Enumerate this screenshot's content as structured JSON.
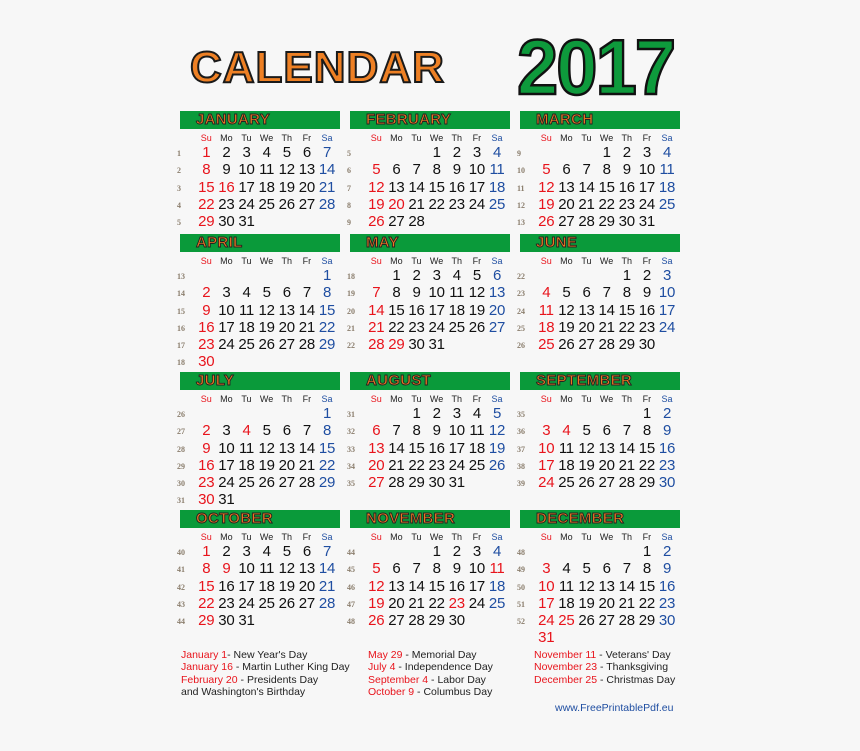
{
  "header": {
    "title": "CALENDAR",
    "year": "2017"
  },
  "colors": {
    "month_bar": "#0a9a3a",
    "title_orange": "#ee8024",
    "year_green": "#0e9a3c",
    "sunday_holiday_red": "#e8141c",
    "saturday_blue": "#1f4ea1"
  },
  "weekdays": [
    "Su",
    "Mo",
    "Tu",
    "We",
    "Th",
    "Fr",
    "Sa"
  ],
  "months": [
    {
      "name": "JANUARY",
      "weeks": [
        {
          "wk": "1",
          "days": [
            "1",
            "2",
            "3",
            "4",
            "5",
            "6",
            "7"
          ]
        },
        {
          "wk": "2",
          "days": [
            "8",
            "9",
            "10",
            "11",
            "12",
            "13",
            "14"
          ]
        },
        {
          "wk": "3",
          "days": [
            "15",
            "16",
            "17",
            "18",
            "19",
            "20",
            "21"
          ]
        },
        {
          "wk": "4",
          "days": [
            "22",
            "23",
            "24",
            "25",
            "26",
            "27",
            "28"
          ]
        },
        {
          "wk": "5",
          "days": [
            "29",
            "30",
            "31",
            "",
            "",
            "",
            ""
          ]
        }
      ],
      "holidays": [
        "1",
        "16"
      ]
    },
    {
      "name": "FEBRUARY",
      "weeks": [
        {
          "wk": "5",
          "days": [
            "",
            "",
            "",
            "1",
            "2",
            "3",
            "4"
          ]
        },
        {
          "wk": "6",
          "days": [
            "5",
            "6",
            "7",
            "8",
            "9",
            "10",
            "11"
          ]
        },
        {
          "wk": "7",
          "days": [
            "12",
            "13",
            "14",
            "15",
            "16",
            "17",
            "18"
          ]
        },
        {
          "wk": "8",
          "days": [
            "19",
            "20",
            "21",
            "22",
            "23",
            "24",
            "25"
          ]
        },
        {
          "wk": "9",
          "days": [
            "26",
            "27",
            "28",
            "",
            "",
            "",
            ""
          ]
        }
      ],
      "holidays": [
        "20"
      ]
    },
    {
      "name": "MARCH",
      "weeks": [
        {
          "wk": "9",
          "days": [
            "",
            "",
            "",
            "1",
            "2",
            "3",
            "4"
          ]
        },
        {
          "wk": "10",
          "days": [
            "5",
            "6",
            "7",
            "8",
            "9",
            "10",
            "11"
          ]
        },
        {
          "wk": "11",
          "days": [
            "12",
            "13",
            "14",
            "15",
            "16",
            "17",
            "18"
          ]
        },
        {
          "wk": "12",
          "days": [
            "19",
            "20",
            "21",
            "22",
            "23",
            "24",
            "25"
          ]
        },
        {
          "wk": "13",
          "days": [
            "26",
            "27",
            "28",
            "29",
            "30",
            "31",
            ""
          ]
        }
      ],
      "holidays": []
    },
    {
      "name": "APRIL",
      "weeks": [
        {
          "wk": "13",
          "days": [
            "",
            "",
            "",
            "",
            "",
            "",
            "1"
          ]
        },
        {
          "wk": "14",
          "days": [
            "2",
            "3",
            "4",
            "5",
            "6",
            "7",
            "8"
          ]
        },
        {
          "wk": "15",
          "days": [
            "9",
            "10",
            "11",
            "12",
            "13",
            "14",
            "15"
          ]
        },
        {
          "wk": "16",
          "days": [
            "16",
            "17",
            "18",
            "19",
            "20",
            "21",
            "22"
          ]
        },
        {
          "wk": "17",
          "days": [
            "23",
            "24",
            "25",
            "26",
            "27",
            "28",
            "29"
          ]
        },
        {
          "wk": "18",
          "days": [
            "30",
            "",
            "",
            "",
            "",
            "",
            ""
          ]
        }
      ],
      "holidays": []
    },
    {
      "name": "MAY",
      "weeks": [
        {
          "wk": "18",
          "days": [
            "",
            "1",
            "2",
            "3",
            "4",
            "5",
            "6"
          ]
        },
        {
          "wk": "19",
          "days": [
            "7",
            "8",
            "9",
            "10",
            "11",
            "12",
            "13"
          ]
        },
        {
          "wk": "20",
          "days": [
            "14",
            "15",
            "16",
            "17",
            "18",
            "19",
            "20"
          ]
        },
        {
          "wk": "21",
          "days": [
            "21",
            "22",
            "23",
            "24",
            "25",
            "26",
            "27"
          ]
        },
        {
          "wk": "22",
          "days": [
            "28",
            "29",
            "30",
            "31",
            "",
            "",
            ""
          ]
        }
      ],
      "holidays": [
        "29"
      ]
    },
    {
      "name": "JUNE",
      "weeks": [
        {
          "wk": "22",
          "days": [
            "",
            "",
            "",
            "",
            "1",
            "2",
            "3"
          ]
        },
        {
          "wk": "23",
          "days": [
            "4",
            "5",
            "6",
            "7",
            "8",
            "9",
            "10"
          ]
        },
        {
          "wk": "24",
          "days": [
            "11",
            "12",
            "13",
            "14",
            "15",
            "16",
            "17"
          ]
        },
        {
          "wk": "25",
          "days": [
            "18",
            "19",
            "20",
            "21",
            "22",
            "23",
            "24"
          ]
        },
        {
          "wk": "26",
          "days": [
            "25",
            "26",
            "27",
            "28",
            "29",
            "30",
            ""
          ]
        }
      ],
      "holidays": []
    },
    {
      "name": "JULY",
      "weeks": [
        {
          "wk": "26",
          "days": [
            "",
            "",
            "",
            "",
            "",
            "",
            "1"
          ]
        },
        {
          "wk": "27",
          "days": [
            "2",
            "3",
            "4",
            "5",
            "6",
            "7",
            "8"
          ]
        },
        {
          "wk": "28",
          "days": [
            "9",
            "10",
            "11",
            "12",
            "13",
            "14",
            "15"
          ]
        },
        {
          "wk": "29",
          "days": [
            "16",
            "17",
            "18",
            "19",
            "20",
            "21",
            "22"
          ]
        },
        {
          "wk": "30",
          "days": [
            "23",
            "24",
            "25",
            "26",
            "27",
            "28",
            "29"
          ]
        },
        {
          "wk": "31",
          "days": [
            "30",
            "31",
            "",
            "",
            "",
            "",
            ""
          ]
        }
      ],
      "holidays": [
        "4"
      ]
    },
    {
      "name": "AUGUST",
      "weeks": [
        {
          "wk": "31",
          "days": [
            "",
            "",
            "1",
            "2",
            "3",
            "4",
            "5"
          ]
        },
        {
          "wk": "32",
          "days": [
            "6",
            "7",
            "8",
            "9",
            "10",
            "11",
            "12"
          ]
        },
        {
          "wk": "33",
          "days": [
            "13",
            "14",
            "15",
            "16",
            "17",
            "18",
            "19"
          ]
        },
        {
          "wk": "34",
          "days": [
            "20",
            "21",
            "22",
            "23",
            "24",
            "25",
            "26"
          ]
        },
        {
          "wk": "35",
          "days": [
            "27",
            "28",
            "29",
            "30",
            "31",
            "",
            ""
          ]
        }
      ],
      "holidays": []
    },
    {
      "name": "SEPTEMBER",
      "weeks": [
        {
          "wk": "35",
          "days": [
            "",
            "",
            "",
            "",
            "",
            "1",
            "2"
          ]
        },
        {
          "wk": "36",
          "days": [
            "3",
            "4",
            "5",
            "6",
            "7",
            "8",
            "9"
          ]
        },
        {
          "wk": "37",
          "days": [
            "10",
            "11",
            "12",
            "13",
            "14",
            "15",
            "16"
          ]
        },
        {
          "wk": "38",
          "days": [
            "17",
            "18",
            "19",
            "20",
            "21",
            "22",
            "23"
          ]
        },
        {
          "wk": "39",
          "days": [
            "24",
            "25",
            "26",
            "27",
            "28",
            "29",
            "30"
          ]
        }
      ],
      "holidays": [
        "4"
      ]
    },
    {
      "name": "OCTOBER",
      "weeks": [
        {
          "wk": "40",
          "days": [
            "1",
            "2",
            "3",
            "4",
            "5",
            "6",
            "7"
          ]
        },
        {
          "wk": "41",
          "days": [
            "8",
            "9",
            "10",
            "11",
            "12",
            "13",
            "14"
          ]
        },
        {
          "wk": "42",
          "days": [
            "15",
            "16",
            "17",
            "18",
            "19",
            "20",
            "21"
          ]
        },
        {
          "wk": "43",
          "days": [
            "22",
            "23",
            "24",
            "25",
            "26",
            "27",
            "28"
          ]
        },
        {
          "wk": "44",
          "days": [
            "29",
            "30",
            "31",
            "",
            "",
            "",
            ""
          ]
        }
      ],
      "holidays": [
        "9"
      ]
    },
    {
      "name": "NOVEMBER",
      "weeks": [
        {
          "wk": "44",
          "days": [
            "",
            "",
            "",
            "1",
            "2",
            "3",
            "4"
          ]
        },
        {
          "wk": "45",
          "days": [
            "5",
            "6",
            "7",
            "8",
            "9",
            "10",
            "11"
          ]
        },
        {
          "wk": "46",
          "days": [
            "12",
            "13",
            "14",
            "15",
            "16",
            "17",
            "18"
          ]
        },
        {
          "wk": "47",
          "days": [
            "19",
            "20",
            "21",
            "22",
            "23",
            "24",
            "25"
          ]
        },
        {
          "wk": "48",
          "days": [
            "26",
            "27",
            "28",
            "29",
            "30",
            "",
            ""
          ]
        }
      ],
      "holidays": [
        "11",
        "23"
      ]
    },
    {
      "name": "DECEMBER",
      "weeks": [
        {
          "wk": "48",
          "days": [
            "",
            "",
            "",
            "",
            "",
            "1",
            "2"
          ]
        },
        {
          "wk": "49",
          "days": [
            "3",
            "4",
            "5",
            "6",
            "7",
            "8",
            "9"
          ]
        },
        {
          "wk": "50",
          "days": [
            "10",
            "11",
            "12",
            "13",
            "14",
            "15",
            "16"
          ]
        },
        {
          "wk": "51",
          "days": [
            "17",
            "18",
            "19",
            "20",
            "21",
            "22",
            "23"
          ]
        },
        {
          "wk": "52",
          "days": [
            "24",
            "25",
            "26",
            "27",
            "28",
            "29",
            "30"
          ]
        },
        {
          "wk": "",
          "days": [
            "31",
            "",
            "",
            "",
            "",
            "",
            ""
          ]
        }
      ],
      "holidays": [
        "25"
      ]
    }
  ],
  "holiday_list": {
    "col1": [
      {
        "date": "January 1",
        "sep": "- ",
        "name": "New Year's Day"
      },
      {
        "date": "January 16",
        "sep": " - ",
        "name": "Martin Luther King Day"
      },
      {
        "date": "February 20",
        "sep": " - ",
        "name": "Presidents Day"
      },
      {
        "date": "",
        "sep": "",
        "name": "and Washington's Birthday"
      }
    ],
    "col2": [
      {
        "date": "May 29",
        "sep": " - ",
        "name": "Memorial Day"
      },
      {
        "date": "July 4",
        "sep": " - ",
        "name": "Independence Day"
      },
      {
        "date": "September 4",
        "sep": " - ",
        "name": "Labor Day"
      },
      {
        "date": "October 9",
        "sep": " - ",
        "name": "Columbus Day"
      }
    ],
    "col3": [
      {
        "date": "November 11",
        "sep": " - ",
        "name": "Veterans' Day"
      },
      {
        "date": "November 23",
        "sep": " - ",
        "name": "Thanksgiving"
      },
      {
        "date": "December 25",
        "sep": " - ",
        "name": "Christmas Day"
      }
    ]
  },
  "footer": {
    "website": "www.FreePrintablePdf.eu"
  }
}
